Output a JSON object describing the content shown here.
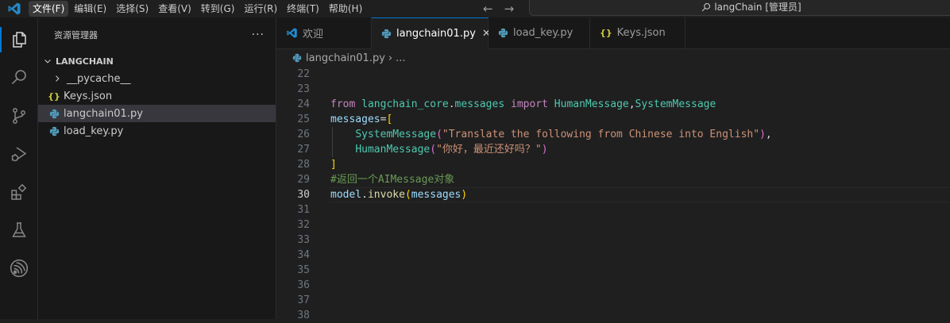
{
  "menu": {
    "items": [
      "文件(F)",
      "编辑(E)",
      "选择(S)",
      "查看(V)",
      "转到(G)",
      "运行(R)",
      "终端(T)",
      "帮助(H)"
    ],
    "active_index": 0
  },
  "search": {
    "text": "langChain [管理员]"
  },
  "sidebar": {
    "title": "资源管理器",
    "more": "···",
    "section": "LANGCHAIN",
    "items": [
      {
        "label": "__pycache__",
        "icon": "chevron-right-icon"
      },
      {
        "label": "Keys.json",
        "icon": "json-icon"
      },
      {
        "label": "langchain01.py",
        "icon": "python-icon"
      },
      {
        "label": "load_key.py",
        "icon": "python-icon"
      }
    ],
    "selected_index": 2
  },
  "tabs": [
    {
      "label": "欢迎",
      "icon": "vscode-icon"
    },
    {
      "label": "langchain01.py",
      "icon": "python-icon",
      "close": "✕"
    },
    {
      "label": "load_key.py",
      "icon": "python-icon"
    },
    {
      "label": "Keys.json",
      "icon": "json-icon"
    }
  ],
  "active_tab": 1,
  "breadcrumb": {
    "file": "langchain01.py",
    "sep": "›",
    "rest": "..."
  },
  "editor": {
    "current_line": 30,
    "lines": [
      {
        "n": "22",
        "t": []
      },
      {
        "n": "23",
        "t": []
      },
      {
        "n": "24",
        "t": [
          [
            "kw",
            "from"
          ],
          [
            "pl",
            " "
          ],
          [
            "mod",
            "langchain_core"
          ],
          [
            "pl",
            "."
          ],
          [
            "mod",
            "messages"
          ],
          [
            "pl",
            " "
          ],
          [
            "kw",
            "import"
          ],
          [
            "pl",
            " "
          ],
          [
            "cls",
            "HumanMessage"
          ],
          [
            "pl",
            ","
          ],
          [
            "cls",
            "SystemMessage"
          ]
        ]
      },
      {
        "n": "25",
        "t": [
          [
            "var",
            "messages"
          ],
          [
            "pl",
            "="
          ],
          [
            "br1",
            "["
          ]
        ]
      },
      {
        "n": "26",
        "t": [
          [
            "pl",
            "    "
          ],
          [
            "cls",
            "SystemMessage"
          ],
          [
            "br2",
            "("
          ],
          [
            "str",
            "\"Translate the following from Chinese into English\""
          ],
          [
            "br2",
            ")"
          ],
          [
            "pl",
            ","
          ]
        ]
      },
      {
        "n": "27",
        "t": [
          [
            "pl",
            "    "
          ],
          [
            "cls",
            "HumanMessage"
          ],
          [
            "br2",
            "("
          ],
          [
            "str",
            "\"你好，最近还好吗？\""
          ],
          [
            "br2",
            ")"
          ]
        ]
      },
      {
        "n": "28",
        "t": [
          [
            "br1",
            "]"
          ]
        ]
      },
      {
        "n": "29",
        "t": [
          [
            "cmt",
            "#返回一个AIMessage对象"
          ]
        ]
      },
      {
        "n": "30",
        "t": [
          [
            "var",
            "model"
          ],
          [
            "pl",
            "."
          ],
          [
            "fn",
            "invoke"
          ],
          [
            "br1",
            "("
          ],
          [
            "var",
            "messages"
          ],
          [
            "br1",
            ")"
          ]
        ]
      },
      {
        "n": "31",
        "t": []
      },
      {
        "n": "32",
        "t": []
      },
      {
        "n": "33",
        "t": []
      },
      {
        "n": "34",
        "t": []
      },
      {
        "n": "35",
        "t": []
      },
      {
        "n": "36",
        "t": []
      },
      {
        "n": "37",
        "t": []
      },
      {
        "n": "38",
        "t": []
      }
    ]
  },
  "colors": {
    "accent": "#0078d4",
    "keyword": "#c586c0",
    "class": "#4ec9b0",
    "variable": "#9cdcfe",
    "string": "#ce9178",
    "comment": "#6a9955",
    "function": "#dcdcaa"
  }
}
